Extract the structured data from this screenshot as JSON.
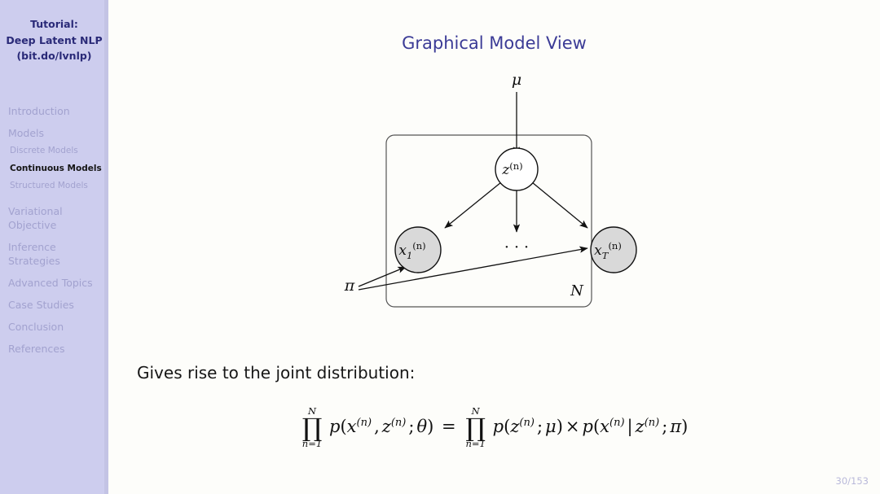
{
  "sidebar": {
    "title_lines": [
      "Tutorial:",
      "Deep Latent NLP",
      "(bit.do/lvnlp)"
    ],
    "sections": [
      {
        "label": "Introduction",
        "active": false,
        "subitems": []
      },
      {
        "label": "Models",
        "active": false,
        "subitems": [
          {
            "label": "Discrete Models",
            "active": false
          },
          {
            "label": "Continuous Models",
            "active": true
          },
          {
            "label": "Structured Models",
            "active": false
          }
        ]
      },
      {
        "label": "Variational Objective",
        "active": false,
        "subitems": []
      },
      {
        "label": "Inference Strategies",
        "active": false,
        "subitems": []
      },
      {
        "label": "Advanced Topics",
        "active": false,
        "subitems": []
      },
      {
        "label": "Case Studies",
        "active": false,
        "subitems": []
      },
      {
        "label": "Conclusion",
        "active": false,
        "subitems": []
      },
      {
        "label": "References",
        "active": false,
        "subitems": []
      }
    ],
    "colors": {
      "background": "#cdcdee",
      "title_text": "#2a2a78",
      "item_text": "#a2a2cf",
      "active_text": "#151515"
    }
  },
  "slide": {
    "title": "Graphical Model View",
    "title_color": "#3b3b96",
    "body_text": "Gives rise to the joint distribution:",
    "page_number": "30/153"
  },
  "diagram": {
    "nodes": [
      {
        "id": "mu",
        "label": "μ",
        "type": "parameter",
        "shaded": false
      },
      {
        "id": "pi",
        "label": "π",
        "type": "parameter",
        "shaded": false
      },
      {
        "id": "z",
        "label": "z",
        "superscript": "(n)",
        "subscript": "",
        "type": "latent",
        "shaded": false
      },
      {
        "id": "x1",
        "label": "x",
        "superscript": "(n)",
        "subscript": "1",
        "type": "observed",
        "shaded": true
      },
      {
        "id": "xT",
        "label": "x",
        "superscript": "(n)",
        "subscript": "T",
        "type": "observed",
        "shaded": true
      }
    ],
    "ellipsis": "· · ·",
    "plate_label": "N",
    "edges": [
      {
        "from": "mu",
        "to": "z"
      },
      {
        "from": "z",
        "to": "x1"
      },
      {
        "from": "z",
        "to": "ellipsis"
      },
      {
        "from": "z",
        "to": "xT"
      },
      {
        "from": "pi",
        "to": "x1"
      },
      {
        "from": "pi",
        "to": "xT"
      }
    ],
    "colors": {
      "shaded_fill": "#d9d9d9",
      "unshaded_fill": "#ffffff",
      "stroke": "#1a1a1a",
      "plate_stroke": "#555555"
    }
  },
  "formula": {
    "lhs": {
      "product": {
        "symbol": "∏",
        "upper": "N",
        "lower": "n=1"
      },
      "expression_parts": [
        {
          "t": "p("
        },
        {
          "t": "x",
          "style": "it"
        },
        {
          "t": "(n)",
          "style": "sup"
        },
        {
          "t": ", "
        },
        {
          "t": "z",
          "style": "it"
        },
        {
          "t": "(n)",
          "style": "sup"
        },
        {
          "t": "; "
        },
        {
          "t": "θ",
          "style": "it"
        },
        {
          "t": ")"
        }
      ]
    },
    "equals": "=",
    "rhs": {
      "product": {
        "symbol": "∏",
        "upper": "N",
        "lower": "n=1"
      },
      "expression_parts": [
        {
          "t": "p("
        },
        {
          "t": "z",
          "style": "it"
        },
        {
          "t": "(n)",
          "style": "sup"
        },
        {
          "t": "; "
        },
        {
          "t": "μ",
          "style": "it"
        },
        {
          "t": ")"
        },
        {
          "t": " × "
        },
        {
          "t": "p("
        },
        {
          "t": "x",
          "style": "it"
        },
        {
          "t": "(n)",
          "style": "sup"
        },
        {
          "t": " | "
        },
        {
          "t": "z",
          "style": "it"
        },
        {
          "t": "(n)",
          "style": "sup"
        },
        {
          "t": "; "
        },
        {
          "t": "π",
          "style": "it"
        },
        {
          "t": ")"
        }
      ]
    },
    "plain_text": "∏(n=1..N) p(x^(n), z^(n); θ) = ∏(n=1..N) p(z^(n); μ) × p(x^(n) | z^(n); π)"
  }
}
